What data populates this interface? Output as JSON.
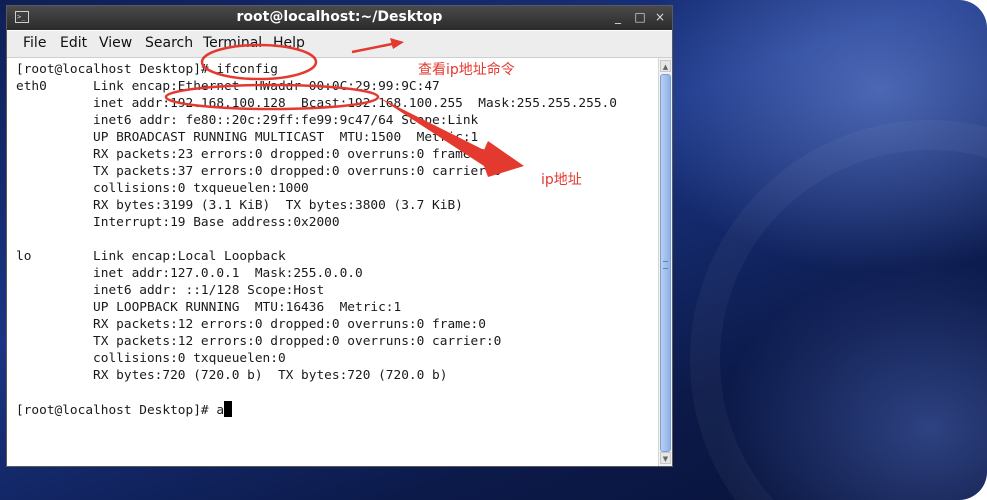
{
  "window": {
    "title": "root@localhost:~/Desktop",
    "controls": {
      "minimize": "_",
      "maximize": "□",
      "close": "×"
    }
  },
  "menubar": {
    "items": [
      "File",
      "Edit",
      "View",
      "Search",
      "Terminal",
      "Help"
    ]
  },
  "terminal": {
    "lines": [
      "[root@localhost Desktop]# ifconfig",
      "eth0      Link encap:Ethernet  HWaddr 00:0C:29:99:9C:47",
      "          inet addr:192.168.100.128  Bcast:192.168.100.255  Mask:255.255.255.0",
      "          inet6 addr: fe80::20c:29ff:fe99:9c47/64 Scope:Link",
      "          UP BROADCAST RUNNING MULTICAST  MTU:1500  Metric:1",
      "          RX packets:23 errors:0 dropped:0 overruns:0 frame:0",
      "          TX packets:37 errors:0 dropped:0 overruns:0 carrier:0",
      "          collisions:0 txqueuelen:1000",
      "          RX bytes:3199 (3.1 KiB)  TX bytes:3800 (3.7 KiB)",
      "          Interrupt:19 Base address:0x2000",
      "",
      "lo        Link encap:Local Loopback",
      "          inet addr:127.0.0.1  Mask:255.0.0.0",
      "          inet6 addr: ::1/128 Scope:Host",
      "          UP LOOPBACK RUNNING  MTU:16436  Metric:1",
      "          RX packets:12 errors:0 dropped:0 overruns:0 frame:0",
      "          TX packets:12 errors:0 dropped:0 overruns:0 carrier:0",
      "          collisions:0 txqueuelen:0",
      "          RX bytes:720 (720.0 b)  TX bytes:720 (720.0 b)",
      ""
    ],
    "prompt": "[root@localhost Desktop]# ",
    "current_input": "a"
  },
  "annotations": {
    "command_label": "查看ip地址命令",
    "ip_label": "ip地址",
    "color": "#e4392f"
  }
}
